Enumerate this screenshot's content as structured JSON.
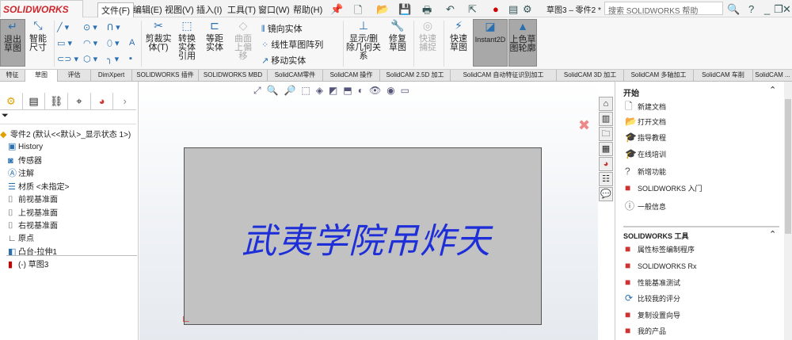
{
  "app": {
    "logo": "SOLIDWORKS",
    "doc_title": "草图3 – 零件2 *",
    "search_placeholder": "搜索 SOLIDWORKS 帮助"
  },
  "menu": [
    "文件(F)",
    "编辑(E)",
    "视图(V)",
    "插入(I)",
    "工具(T)",
    "窗口(W)",
    "帮助(H)"
  ],
  "ribbon": {
    "exit_sketch": "退出草图",
    "smart_dim": "智能尺寸",
    "trim": "剪裁实体(T)",
    "convert": "转换实体引用",
    "offset": "等距实体",
    "surface_offset": "曲面上偏移",
    "mirror": "镜向实体",
    "linear_pattern": "线性草图阵列",
    "move": "移动实体",
    "show_relations": "显示/删除几何关系",
    "repair": "修复草图",
    "quick_snap": "快速捕捉",
    "rapid_sketch": "快速草图",
    "instant2d": "Instant2D",
    "shaded": "上色草图轮廓"
  },
  "tabs": [
    "特征",
    "草图",
    "评估",
    "DimXpert",
    "SOLIDWORKS 插件",
    "SOLIDWORKS MBD",
    "SolidCAM零件",
    "SolidCAM 操作",
    "SolidCAM 2.5D 加工",
    "SolidCAM 自动特征识别加工",
    "SolidCAM 3D 加工",
    "SolidCAM 多轴加工",
    "SolidCAM 车削",
    "SolidCAM ..."
  ],
  "tree": {
    "root": "零件2 (默认<<默认>_显示状态 1>)",
    "items": [
      "History",
      "传感器",
      "注解",
      "材质 <未指定>",
      "前视基准面",
      "上视基准面",
      "右视基准面",
      "原点",
      "凸台-拉伸1",
      "(-) 草图3"
    ]
  },
  "canvas": {
    "sketch_text": "武夷学院吊炸天",
    "text_color": "#1f2fd8"
  },
  "taskpane": {
    "start_title": "开始",
    "start_items": [
      "新建文档",
      "打开文档",
      "指导教程",
      "在线培训",
      "新增功能",
      "SOLIDWORKS 入门",
      "一般信息"
    ],
    "tools_title": "SOLIDWORKS 工具",
    "tools_items": [
      "属性标签编制程序",
      "SOLIDWORKS Rx",
      "性能基准测试",
      "比较我的评分",
      "复制设置向导",
      "我的产品"
    ]
  }
}
